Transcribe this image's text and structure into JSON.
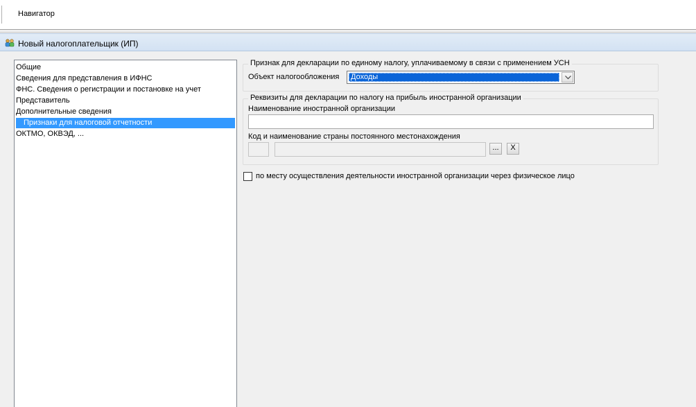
{
  "toolbar": {
    "navigator_label": "Навигатор"
  },
  "window": {
    "title": "Новый налогоплательщик (ИП)",
    "icon": "people-icon"
  },
  "tree": {
    "items": [
      {
        "label": "Общие",
        "selected": false
      },
      {
        "label": "Сведения для представления в ИФНС",
        "selected": false
      },
      {
        "label": "ФНС. Сведения о регистрации и постановке на учет",
        "selected": false
      },
      {
        "label": "Представитель",
        "selected": false
      },
      {
        "label": "Дополнительные сведения",
        "selected": false
      },
      {
        "label": "Признаки для налоговой отчетности",
        "selected": true
      },
      {
        "label": "ОКТМО, ОКВЭД, ...",
        "selected": false
      }
    ]
  },
  "usn_group": {
    "legend": "Признак для декларации по единому налогу, уплачиваемому в связи с применением УСН",
    "object_label": "Объект налогообложения",
    "object_value": "Доходы"
  },
  "foreign_group": {
    "legend": "Реквизиты для декларации по налогу на прибыль иностранной организации",
    "name_label": "Наименование иностранной организации",
    "name_value": "",
    "country_label": "Код и наименование страны постоянного местонахождения",
    "country_code": "",
    "country_name": "",
    "browse_label": "...",
    "clear_label": "X"
  },
  "checkbox": {
    "label": "по месту осуществления деятельности иностранной организации через физическое лицо",
    "checked": false
  }
}
